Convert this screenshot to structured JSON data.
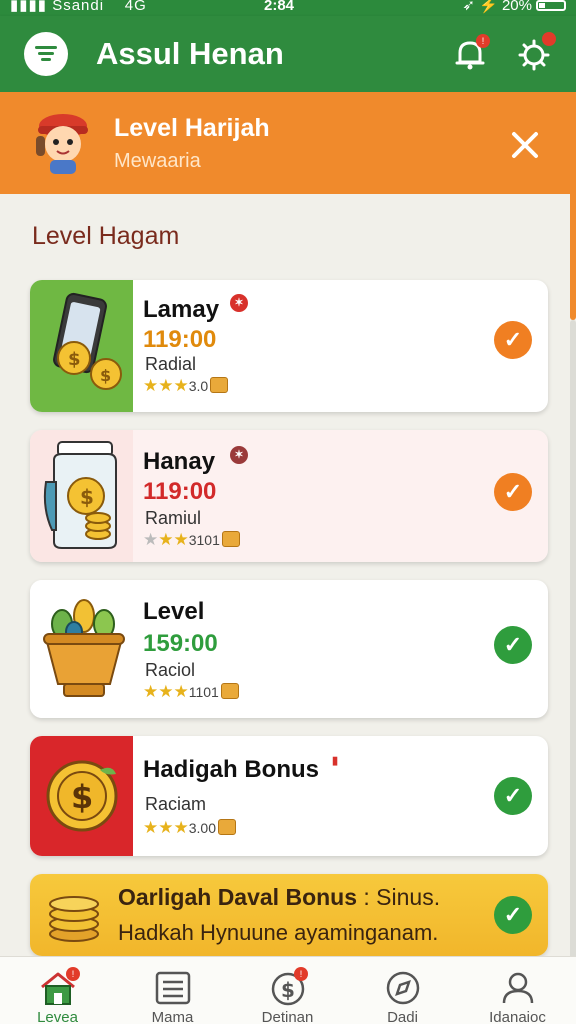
{
  "status_bar": {
    "carrier": "Ssandi",
    "network": "4G",
    "time": "2:84",
    "battery": "20%"
  },
  "header": {
    "title": "Assul Henan",
    "menu_icon": "menu-icon",
    "bell_icon": "bell-icon",
    "profile_icon": "settings-icon",
    "bell_badge": "!"
  },
  "banner": {
    "title": "Level Harijah",
    "subtitle": "Mewaaria",
    "close_icon": "close-icon"
  },
  "section": {
    "title": "Level Hagam"
  },
  "levels": [
    {
      "title": "Lamay",
      "amount": "119:00",
      "amount_color": "#e08a0c",
      "label": "Radial",
      "rating": "3.0",
      "status": "done-orange"
    },
    {
      "title": "Hanay",
      "amount": "119:00",
      "amount_color": "#d22a2a",
      "label": "Ramiul",
      "rating": "3101",
      "status": "done-orange"
    },
    {
      "title": "Level",
      "amount": "159:00",
      "amount_color": "#2f9d3d",
      "label": "Raciol",
      "rating": "1101",
      "status": "done-green"
    },
    {
      "title": "Hadigah Bonus",
      "label": "Raciam",
      "rating": "3.00",
      "status": "done-green"
    }
  ],
  "bonus": {
    "title": "Oarligah Daval Bonus",
    "title_tail": ": Sinus.",
    "subtitle": "Hadkah Hynuune ayaminganam."
  },
  "nav": [
    {
      "label": "Levea",
      "icon": "home-icon",
      "active": true
    },
    {
      "label": "Mama",
      "icon": "list-icon",
      "active": false
    },
    {
      "label": "Detinan",
      "icon": "dollar-icon",
      "active": false
    },
    {
      "label": "Dadi",
      "icon": "compass-icon",
      "active": false
    },
    {
      "label": "Idanaioc",
      "icon": "user-icon",
      "active": false
    }
  ],
  "colors": {
    "green": "#2f8b3e",
    "orange": "#f08a2c",
    "check_orange": "#f07f22",
    "check_green": "#2f9d3d"
  }
}
